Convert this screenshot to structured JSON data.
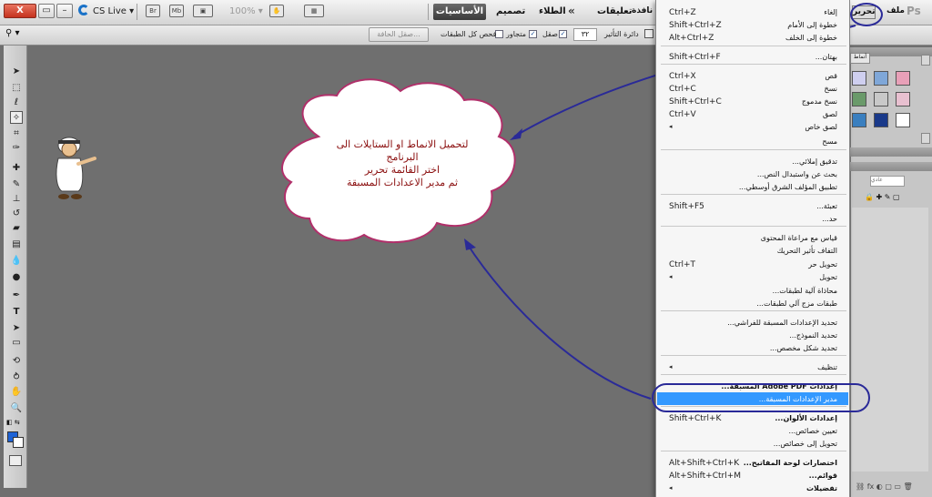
{
  "titlebar": {
    "close_label": "X",
    "cs_live": "CS Live ▾",
    "zoom": "100% ▾",
    "ps_logo": "Ps",
    "icon_br": "Br",
    "icon_mb": "Mb",
    "icon_view": "▣",
    "icon_grid": "▦",
    "workspace_active": "الأساسيات",
    "workspace_design": "تصميم",
    "workspace_paint": "الطلاء",
    "workspace_more": "«",
    "workspace_notes": "تعليقات"
  },
  "menubar": {
    "file": "ملف",
    "edit": "تحرير",
    "window": "نافذة"
  },
  "options": {
    "refine_edge": "صقل الحافة...",
    "sample_all_layers": "فحص كل الطبقات",
    "contiguous": "متجاور",
    "anti_alias": "صقل",
    "tolerance_label": "دائرة التأثير",
    "tolerance_value": "٣٢"
  },
  "edit_menu": {
    "items": [
      {
        "label": "إلغاء",
        "shortcut": "Ctrl+Z"
      },
      {
        "label": "خطوة إلى الأمام",
        "shortcut": "Shift+Ctrl+Z"
      },
      {
        "label": "خطوة إلى الخلف",
        "shortcut": "Alt+Ctrl+Z"
      },
      {
        "label": "بهتان...",
        "shortcut": "Shift+Ctrl+F"
      },
      {
        "label": "قص",
        "shortcut": "Ctrl+X"
      },
      {
        "label": "نسخ",
        "shortcut": "Ctrl+C"
      },
      {
        "label": "نسخ مدموج",
        "shortcut": "Shift+Ctrl+C"
      },
      {
        "label": "لصق",
        "shortcut": "Ctrl+V"
      },
      {
        "label": "لصق خاص",
        "shortcut": "◂"
      },
      {
        "label": "مسح",
        "shortcut": ""
      },
      {
        "label": "تدقيق إملائي...",
        "shortcut": ""
      },
      {
        "label": "بحث عن واستبدال النص...",
        "shortcut": ""
      },
      {
        "label": "تطبيق المؤلف الشرق أوسطي...",
        "shortcut": ""
      },
      {
        "label": "تعبئة...",
        "shortcut": "Shift+F5"
      },
      {
        "label": "حد...",
        "shortcut": ""
      },
      {
        "label": "قياس مع مراعاة المحتوى",
        "shortcut": ""
      },
      {
        "label": "التفاف تأثير التحريك",
        "shortcut": ""
      },
      {
        "label": "تحويل حر",
        "shortcut": "Ctrl+T"
      },
      {
        "label": "تحويل",
        "shortcut": "◂"
      },
      {
        "label": "محاذاة آلية لطبقات...",
        "shortcut": ""
      },
      {
        "label": "طبقات مزج آلي لطبقات...",
        "shortcut": ""
      },
      {
        "label": "تحديد الإعدادات المسبقة للفراشي...",
        "shortcut": ""
      },
      {
        "label": "تحديد النموذج...",
        "shortcut": ""
      },
      {
        "label": "تحديد شكل مخصص...",
        "shortcut": ""
      },
      {
        "label": "تنظيف",
        "shortcut": "◂"
      },
      {
        "label": "إعدادات Adobe PDF المسبقة...",
        "shortcut": ""
      },
      {
        "label": "مدير الإعدادات المسبقة...",
        "shortcut": ""
      },
      {
        "label": "إعدادات الألوان...",
        "shortcut": "Shift+Ctrl+K"
      },
      {
        "label": "تعيين خصائص...",
        "shortcut": ""
      },
      {
        "label": "تحويل إلى خصائص...",
        "shortcut": ""
      },
      {
        "label": "اختصارات لوحة المفاتيح...",
        "shortcut": "Alt+Shift+Ctrl+K"
      },
      {
        "label": "قوائم...",
        "shortcut": "Alt+Shift+Ctrl+M"
      },
      {
        "label": "تفضيلات",
        "shortcut": "◂"
      }
    ]
  },
  "annotation": {
    "line1": "لتحميل الانماط  او الستايلات الى",
    "line2": "البرنامج",
    "line3": "اختر القائمة تحرير",
    "line4": "ثم مدير الاعدادات المسبقة"
  },
  "panels": {
    "tab_label": "أنماط",
    "layers_field": "عادي"
  },
  "colors": {
    "accent_blue": "#3399ff",
    "annotation_ink": "#2a2a98",
    "cloud_border": "#b0306a",
    "cloud_text": "#8a0d0d",
    "fg_color": "#1e63d6"
  }
}
